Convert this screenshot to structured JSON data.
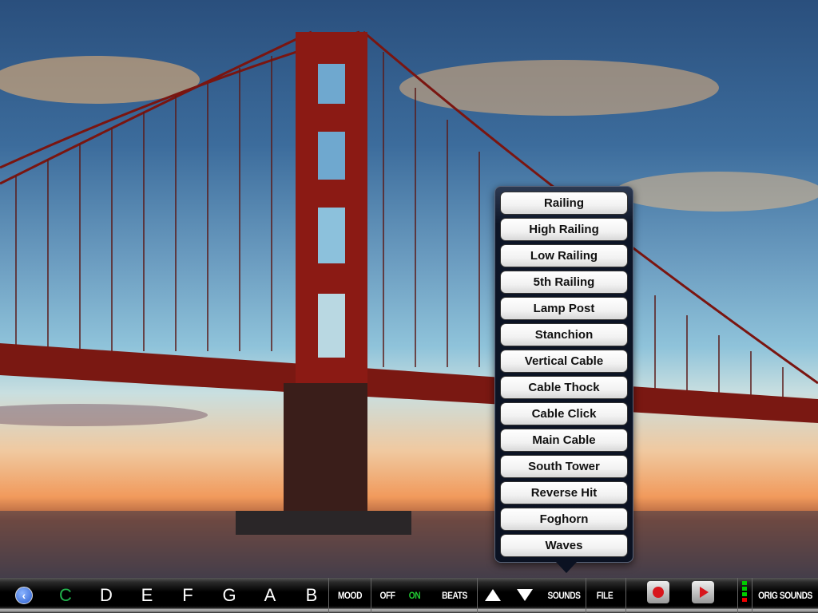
{
  "sound_menu": {
    "items": [
      "Railing",
      "High Railing",
      "Low Railing",
      "5th Railing",
      "Lamp Post",
      "Stanchion",
      "Vertical Cable",
      "Cable Thock",
      "Cable Click",
      "Main Cable",
      "South Tower",
      "Reverse Hit",
      "Foghorn",
      "Waves"
    ]
  },
  "toolbar": {
    "back_icon": "chevron-left-circle-icon",
    "notes": [
      "C",
      "D",
      "E",
      "F",
      "G",
      "A",
      "B"
    ],
    "selected_note": "C",
    "mood": "MOOD",
    "off": "OFF",
    "on": "ON",
    "beats": "BEATS",
    "sounds": "SOUNDS",
    "file": "FILE",
    "orig_sounds": "ORIG SOUNDS",
    "level_meter": {
      "green_segments": 3,
      "red_segments": 1
    }
  },
  "colors": {
    "selected": "#22b24c",
    "on": "#22cc33",
    "record": "#d8161c",
    "bridge": "#8b1a14"
  }
}
